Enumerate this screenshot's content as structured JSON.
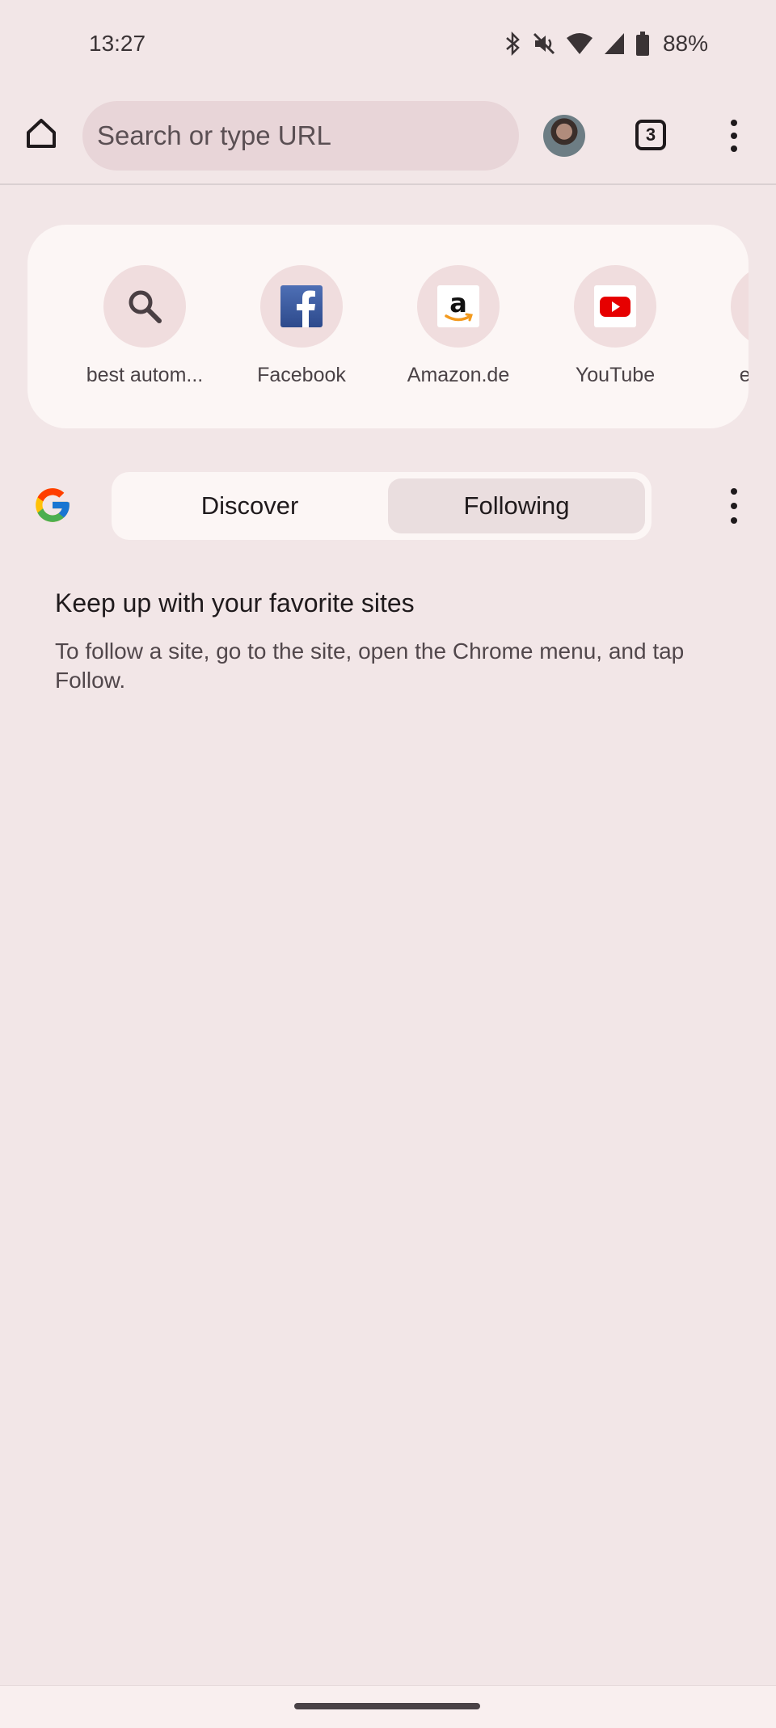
{
  "status_bar": {
    "time": "13:27",
    "battery": "88%",
    "icons": [
      "bluetooth-icon",
      "mute-icon",
      "wifi-icon",
      "signal-icon",
      "battery-icon"
    ]
  },
  "toolbar": {
    "omnibox_placeholder": "Search or type URL",
    "tab_count": "3"
  },
  "shortcuts": [
    {
      "label": "best autom...",
      "icon": "search-icon"
    },
    {
      "label": "Facebook",
      "icon": "facebook-icon"
    },
    {
      "label": "Amazon.de",
      "icon": "amazon-icon"
    },
    {
      "label": "YouTube",
      "icon": "youtube-icon"
    },
    {
      "label": "eBay K",
      "icon": "ebay-kleinanzeigen-icon"
    }
  ],
  "feed": {
    "tabs": [
      {
        "label": "Discover",
        "selected": false
      },
      {
        "label": "Following",
        "selected": true
      }
    ]
  },
  "following_empty": {
    "title": "Keep up with your favorite sites",
    "description": "To follow a site, go to the site, open the Chrome menu, and tap Follow."
  },
  "colors": {
    "background": "#F2E6E7",
    "card": "#FCF6F5",
    "omnibox": "#E8D5D8",
    "selected_tab": "#EADEDF"
  }
}
